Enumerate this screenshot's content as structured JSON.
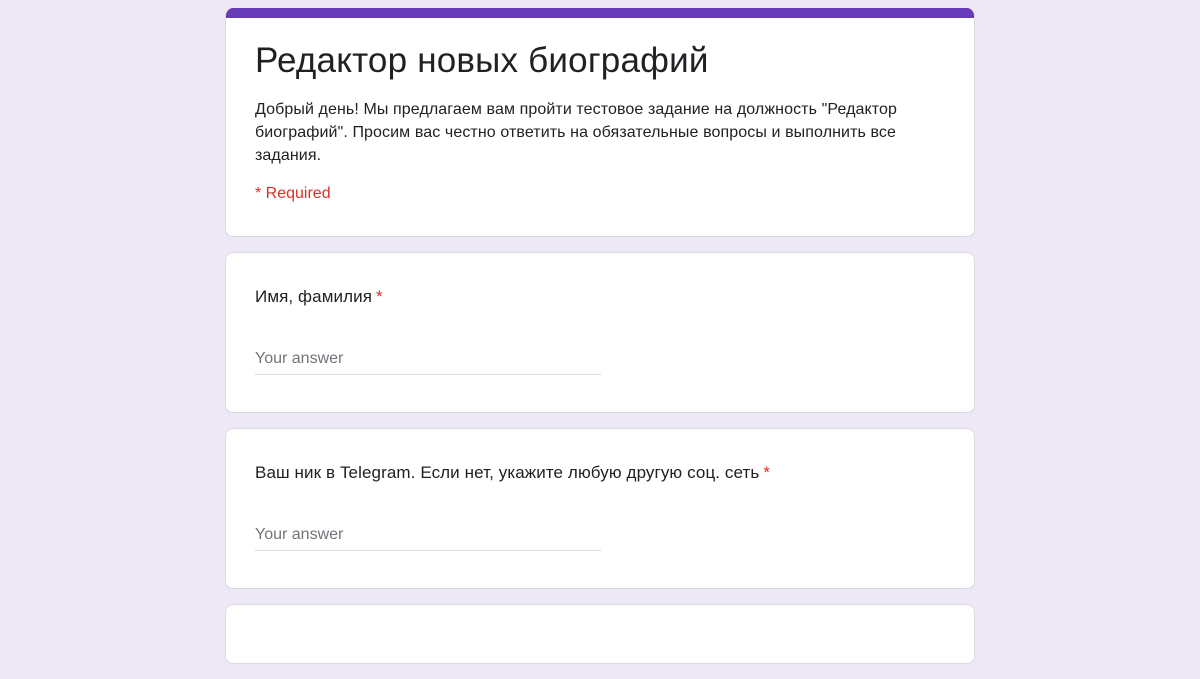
{
  "form": {
    "title": "Редактор новых биографий",
    "description": "Добрый день! Мы предлагаем вам пройти тестовое задание на должность \"Редактор биографий\". Просим вас честно ответить на обязательные вопросы и выполнить все задания.",
    "required_note": "* Required",
    "accent_color": "#673ab7",
    "background_color": "#ede7f6",
    "required_color": "#d93025"
  },
  "questions": [
    {
      "label": "Имя, фамилия",
      "required_mark": "*",
      "answer_value": "",
      "placeholder": "Your answer"
    },
    {
      "label": "Ваш ник в Telegram. Если нет, укажите любую другую соц. сеть",
      "required_mark": "*",
      "answer_value": "",
      "placeholder": "Your answer"
    }
  ]
}
